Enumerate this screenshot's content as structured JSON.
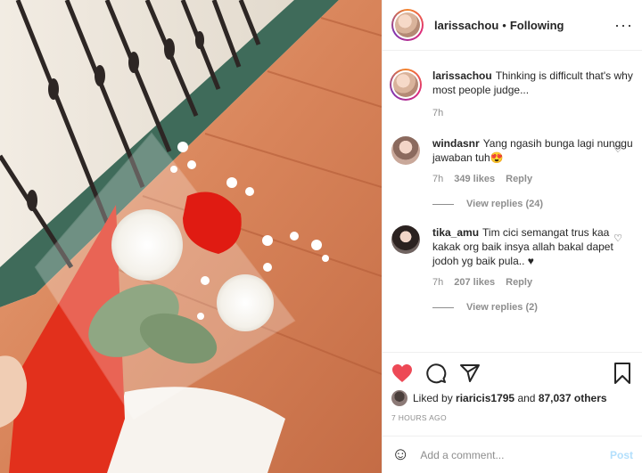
{
  "post": {
    "username": "larissachou",
    "separator": "•",
    "follow_status": "Following",
    "caption": "Thinking is difficult that's why most people judge...",
    "caption_time": "7h"
  },
  "comments": [
    {
      "username": "windasnr",
      "text": "Yang ngasih bunga lagi nunggu jawaban tuh😍",
      "time": "7h",
      "likes": "349 likes",
      "reply_label": "Reply",
      "view_replies": "View replies (24)"
    },
    {
      "username": "tika_amu",
      "text": "Tim cici semangat trus kaa kakak org baik insya allah bakal dapet jodoh yg baik pula.. ♥",
      "time": "7h",
      "likes": "207 likes",
      "reply_label": "Reply",
      "view_replies": "View replies (2)"
    }
  ],
  "engagement": {
    "liked_by_prefix": "Liked by",
    "liked_by_user": "riaricis1795",
    "liked_by_suffix": "and",
    "others": "87,037 others",
    "timestamp": "7 HOURS AGO"
  },
  "composer": {
    "placeholder": "Add a comment...",
    "post_label": "Post"
  },
  "icons": {
    "like": "heart-icon",
    "comment": "comment-icon",
    "share": "share-icon",
    "save": "bookmark-icon",
    "options": "more-icon",
    "emoji": "emoji-icon"
  },
  "colors": {
    "like_active": "#ed4956",
    "post_disabled": "#b2dffc",
    "muted_text": "#8e8e8e"
  }
}
